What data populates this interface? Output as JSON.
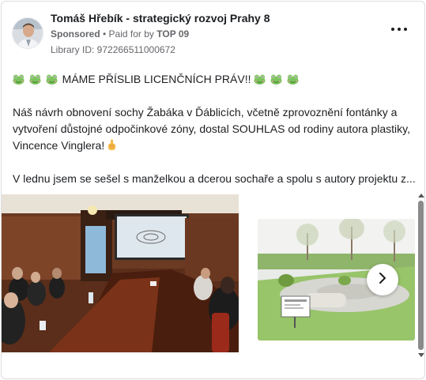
{
  "ad": {
    "page_name": "Tomáš Hřebík - strategický rozvoj Prahy 8",
    "sponsored_label": "Sponsored",
    "separator": " • ",
    "paid_for_by_prefix": "Paid for by ",
    "payer": "TOP 09",
    "library_id": "Library ID: 972266511000672"
  },
  "post": {
    "headline": "MÁME PŘÍSLIB LICENČNÍCH PRÁV!!",
    "paragraph_1": "Náš návrh obnovení sochy Žabáka v Ďáblicích, včetně zprovoznění fontánky a vytvoření důstojné odpočinkové zóny, dostal SOUHLAS od rodiny autora plastiky, Vincence Vinglera!",
    "paragraph_2": "V lednu jsem se sešel s manželkou a dcerou sochaře a spolu s autory projektu z..."
  },
  "icons": {
    "frog": "frog-emoji-icon",
    "hand": "raised-finger-emoji-icon",
    "more": "more-options-icon",
    "next": "chevron-right-icon"
  },
  "colors": {
    "text": "#1c1e21",
    "secondary_text": "#65676b",
    "border": "#dadde1"
  }
}
